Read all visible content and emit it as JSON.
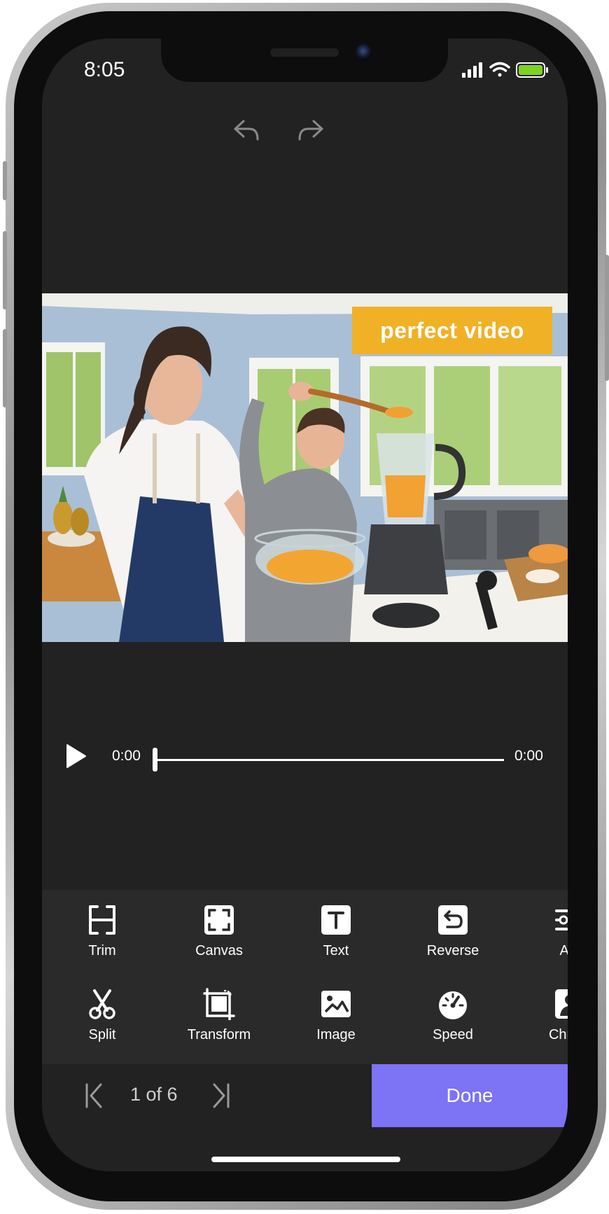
{
  "status_bar": {
    "time": "8:05"
  },
  "header": {
    "undo_icon": "undo-icon",
    "redo_icon": "redo-icon"
  },
  "preview": {
    "watermark": "perfect video"
  },
  "player": {
    "current_time": "0:00",
    "duration": "0:00",
    "progress": 0
  },
  "tools_row1": [
    {
      "label": "Trim",
      "icon": "trim-icon"
    },
    {
      "label": "Canvas",
      "icon": "canvas-icon"
    },
    {
      "label": "Text",
      "icon": "text-icon"
    },
    {
      "label": "Reverse",
      "icon": "reverse-icon"
    },
    {
      "label": "Adj",
      "icon": "adjust-icon"
    }
  ],
  "tools_row2": [
    {
      "label": "Split",
      "icon": "scissors-icon"
    },
    {
      "label": "Transform",
      "icon": "transform-icon"
    },
    {
      "label": "Image",
      "icon": "image-icon"
    },
    {
      "label": "Speed",
      "icon": "speedometer-icon"
    },
    {
      "label": "Chrom",
      "icon": "chroma-icon"
    }
  ],
  "bottom_bar": {
    "page_label": "1 of 6",
    "done_label": "Done"
  },
  "colors": {
    "background": "#222222",
    "toolbar": "#2a2a2a",
    "accent": "#7c73f5",
    "watermark": "#f0b126",
    "battery": "#7ed321"
  }
}
